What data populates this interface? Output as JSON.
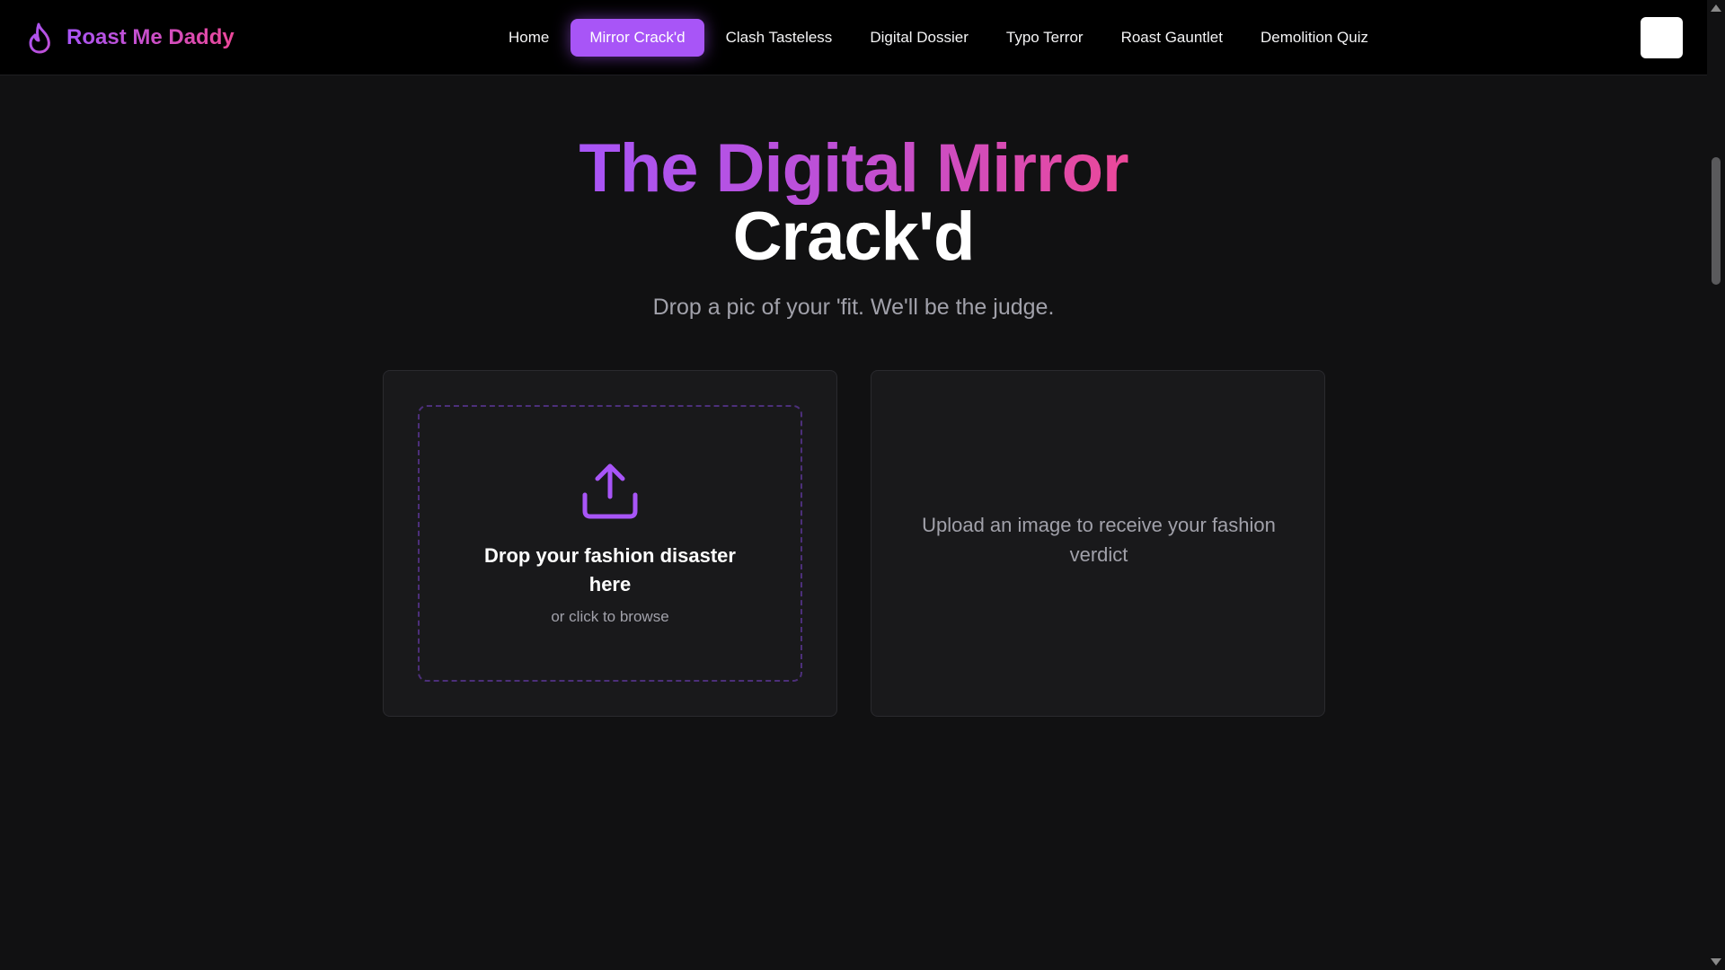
{
  "header": {
    "brand_name": "Roast Me Daddy",
    "brand_icon": "flame-icon",
    "nav": [
      {
        "label": "Home",
        "active": false
      },
      {
        "label": "Mirror Crack'd",
        "active": true
      },
      {
        "label": "Clash Tasteless",
        "active": false
      },
      {
        "label": "Digital Dossier",
        "active": false
      },
      {
        "label": "Typo Terror",
        "active": false
      },
      {
        "label": "Roast Gauntlet",
        "active": false
      },
      {
        "label": "Demolition Quiz",
        "active": false
      }
    ],
    "menu_icon": "menu-icon"
  },
  "hero": {
    "title_line1": "The Digital Mirror",
    "title_line2": "Crack'd",
    "subtitle": "Drop a pic of your 'fit. We'll be the judge."
  },
  "upload": {
    "icon": "upload-icon",
    "title": "Drop your fashion disaster here",
    "subtitle": "or click to browse"
  },
  "verdict": {
    "placeholder": "Upload an image to receive your fashion verdict"
  },
  "colors": {
    "accent": "#a855f7",
    "accent_pink": "#ec4899",
    "background": "#111112",
    "card": "#19191b",
    "muted_text": "#a1a1aa"
  }
}
